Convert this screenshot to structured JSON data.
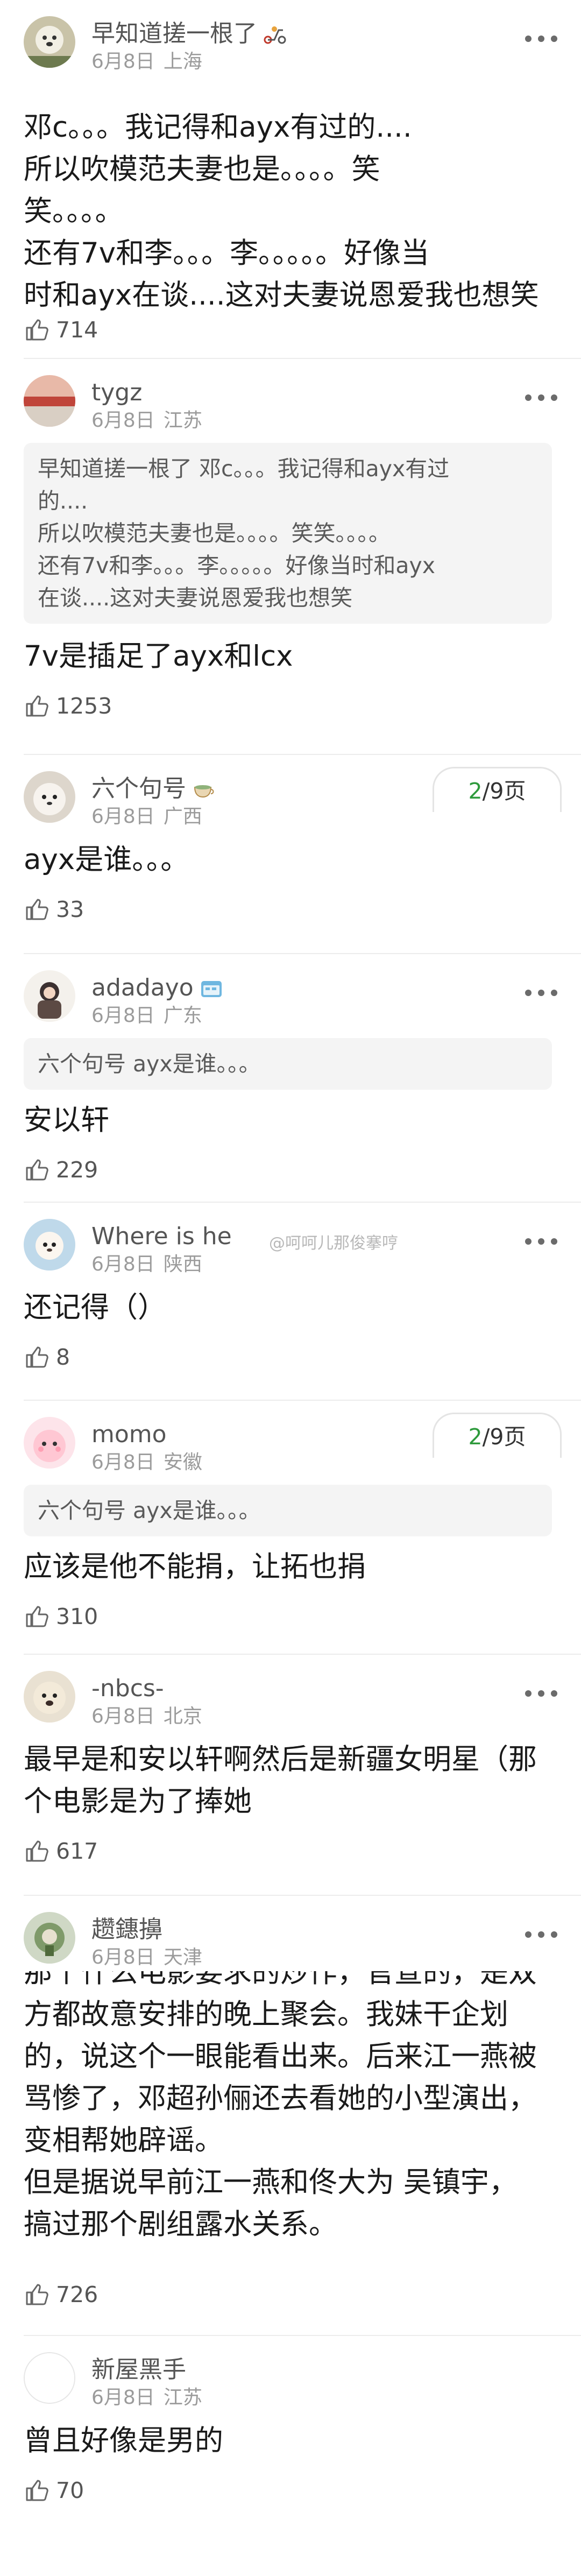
{
  "comments": [
    {
      "name": "早知道搓一根了",
      "date": "6月8日",
      "location": "上海",
      "text": "邓c。。。我记得和ayx有过的....\n所以吹模范夫妻也是。。。。笑\n笑。。。。\n还有7v和李。。。李。。。。。好像当\n时和ayx在谈....这对夫妻说恩爱我也想笑",
      "likes": "714",
      "badge_icon": "scooter-icon"
    },
    {
      "name": "tygz",
      "date": "6月8日",
      "location": "江苏",
      "quote": "早知道搓一根了 邓c。。。我记得和ayx有过\n的....\n所以吹模范夫妻也是。。。。笑笑。。。。\n还有7v和李。。。李。。。。。好像当时和ayx\n在谈....这对夫妻说恩爱我也想笑",
      "text": "7v是插足了ayx和lcx",
      "likes": "1253"
    },
    {
      "name": "六个句号",
      "date": "6月8日",
      "location": "广西",
      "text": "ayx是谁。。。",
      "likes": "33",
      "page_current": "2",
      "page_total": "/9页",
      "badge_icon": "tea-cup-icon"
    },
    {
      "name": "adadayo",
      "date": "6月8日",
      "location": "广东",
      "quote": "六个句号 ayx是谁。。。",
      "text": "安以轩",
      "likes": "229",
      "badge_icon": "calendar-badge-icon"
    },
    {
      "name": "Where is he",
      "date": "6月8日",
      "location": "陕西",
      "text": "还记得（）",
      "likes": "8",
      "watermark": "@呵呵儿那俊搴哼"
    },
    {
      "name": "momo",
      "date": "6月8日",
      "location": "安徽",
      "quote": "六个句号 ayx是谁。。。",
      "text": "应该是他不能捐，让拓也捐",
      "likes": "310",
      "page_current": "2",
      "page_total": "/9页"
    },
    {
      "name": "-nbcs-",
      "date": "6月8日",
      "location": "北京",
      "text": "最早是和安以轩啊然后是新疆女明星（那\n个电影是为了捧她",
      "likes": "617"
    },
    {
      "name": "趱鏸擤",
      "date": "6月8日",
      "location": "天津",
      "text": "那个什么电影要求的炒作，官宣的，是双\n方都故意安排的晚上聚会。我妹干企划\n的，说这个一眼能看出来。后来江一燕被\n骂惨了，邓超孙俪还去看她的小型演出，\n变相帮她辟谣。\n但是据说早前江一燕和佟大为 吴镇宇，\n搞过那个剧组露水关系。",
      "likes": "726"
    },
    {
      "name": "新屋黑手",
      "date": "6月8日",
      "location": "江苏",
      "text": "曾且好像是男的",
      "likes": "70"
    }
  ]
}
